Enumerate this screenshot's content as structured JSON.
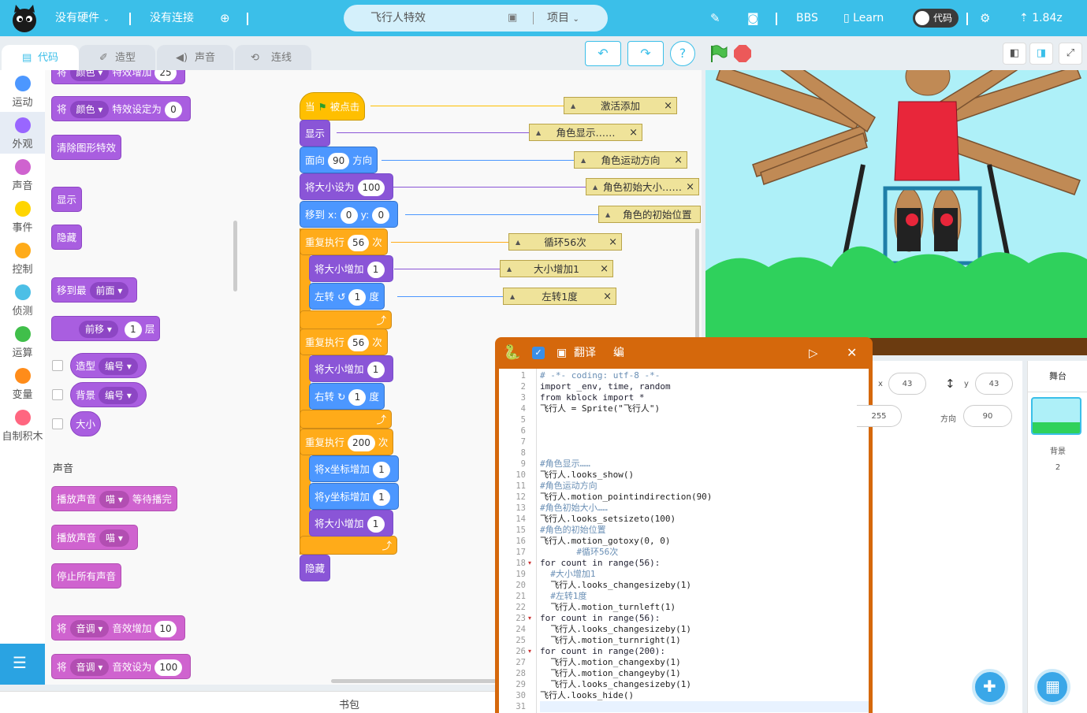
{
  "topbar": {
    "hardware": "没有硬件",
    "connection": "没有连接",
    "project_name": "飞行人特效",
    "project_menu": "项目",
    "bbs": "BBS",
    "learn": "Learn",
    "toggle_label": "代码",
    "version": "1.84z"
  },
  "tabs": [
    {
      "label": "代码"
    },
    {
      "label": "造型"
    },
    {
      "label": "声音"
    },
    {
      "label": "连线"
    }
  ],
  "categories": [
    {
      "label": "运动",
      "color": "#4c97ff"
    },
    {
      "label": "外观",
      "color": "#9966ff"
    },
    {
      "label": "声音",
      "color": "#cf63cf"
    },
    {
      "label": "事件",
      "color": "#ffd500"
    },
    {
      "label": "控制",
      "color": "#ffab19"
    },
    {
      "label": "侦测",
      "color": "#4cbfe6"
    },
    {
      "label": "运算",
      "color": "#40bf4a"
    },
    {
      "label": "变量",
      "color": "#ff8c1a"
    },
    {
      "label": "自制积木",
      "color": "#ff6680"
    }
  ],
  "palette": {
    "b0": {
      "a": "将",
      "b": "颜色",
      "c": "特效增加",
      "d": "25"
    },
    "b1": {
      "a": "将",
      "b": "颜色",
      "c": "特效设定为",
      "d": "0"
    },
    "b2": "清除图形特效",
    "b3": "显示",
    "b4": "隐藏",
    "b5": {
      "a": "移到最",
      "b": "前面"
    },
    "b6": {
      "b": "前移",
      "d": "1",
      "c": "层"
    },
    "b7": {
      "a": "造型",
      "b": "编号"
    },
    "b8": {
      "a": "背景",
      "b": "编号"
    },
    "b9": "大小",
    "sound_header": "声音",
    "s1": {
      "a": "播放声音",
      "b": "喵",
      "c": "等待播完"
    },
    "s2": {
      "a": "播放声音",
      "b": "喵"
    },
    "s3": "停止所有声音",
    "s4": {
      "a": "将",
      "b": "音调",
      "c": "音效增加",
      "d": "10"
    },
    "s5": {
      "a": "将",
      "b": "音调",
      "c": "音效设为",
      "d": "100"
    }
  },
  "script": {
    "hat": {
      "a": "当",
      "b": "被点击"
    },
    "show": "显示",
    "dir": {
      "a": "面向",
      "v": "90",
      "b": "方向"
    },
    "size": {
      "a": "将大小设为",
      "v": "100"
    },
    "goto": {
      "a": "移到 x:",
      "x": "0",
      "b": "y:",
      "y": "0"
    },
    "rep1": {
      "a": "重复执行",
      "v": "56",
      "b": "次"
    },
    "r1a": {
      "a": "将大小增加",
      "v": "1"
    },
    "r1b": {
      "a": "左转",
      "v": "1",
      "b": "度"
    },
    "rep2": {
      "a": "重复执行",
      "v": "56",
      "b": "次"
    },
    "r2a": {
      "a": "将大小增加",
      "v": "1"
    },
    "r2b": {
      "a": "右转",
      "v": "1",
      "b": "度"
    },
    "rep3": {
      "a": "重复执行",
      "v": "200",
      "b": "次"
    },
    "r3a": {
      "a": "将x坐标增加",
      "v": "1"
    },
    "r3b": {
      "a": "将y坐标增加",
      "v": "1"
    },
    "r3c": {
      "a": "将大小增加",
      "v": "1"
    },
    "hide": "隐藏"
  },
  "comments": [
    "激活添加",
    "角色显示……",
    "角色运动方向",
    "角色初始大小……",
    "角色的初始位置",
    "循环56次",
    "大小增加1",
    "左转1度"
  ],
  "python": {
    "translate": "翻译",
    "edit": "编辑"
  },
  "code": [
    "# -*- coding: utf-8 -*-",
    "import _env, time, random",
    "from kblock import *",
    "飞行人 = Sprite(\"飞行人\")",
    "",
    "",
    "",
    "",
    "#角色显示……",
    "飞行人.looks_show()",
    "#角色运动方向",
    "飞行人.motion_pointindirection(90)",
    "#角色初始大小……",
    "飞行人.looks_setsizeto(100)",
    "#角色的初始位置",
    "飞行人.motion_gotoxy(0, 0)",
    "       #循环56次",
    "for count in range(56):",
    "  #大小增加1",
    "  飞行人.looks_changesizeby(1)",
    "  #左转1度",
    "  飞行人.motion_turnleft(1)",
    "for count in range(56):",
    "  飞行人.looks_changesizeby(1)",
    "  飞行人.motion_turnright(1)",
    "for count in range(200):",
    "  飞行人.motion_changexby(1)",
    "  飞行人.motion_changeyby(1)",
    "  飞行人.looks_changesizeby(1)",
    "飞行人.looks_hide()",
    ""
  ],
  "info": {
    "x_label": "x",
    "x": "43",
    "y_label": "y",
    "y": "43",
    "size": "255",
    "dir_label": "方向",
    "dir": "90"
  },
  "stage_panel": {
    "title": "舞台",
    "bg_label": "背景",
    "bg_count": "2"
  },
  "bookbag": "书包"
}
